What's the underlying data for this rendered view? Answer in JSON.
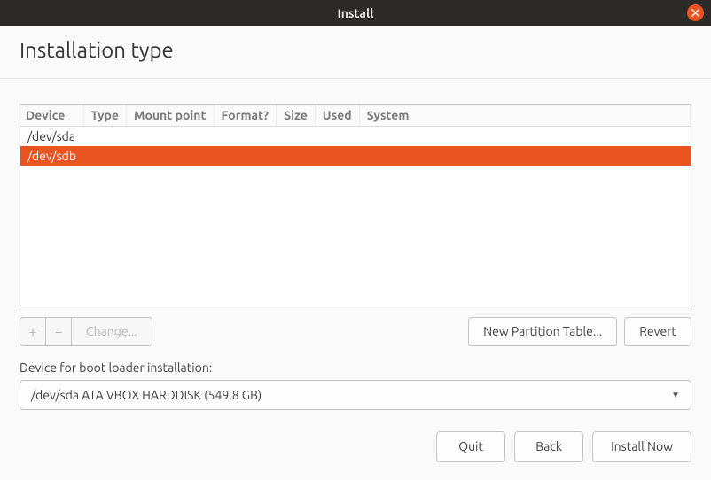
{
  "window": {
    "title": "Install"
  },
  "page": {
    "heading": "Installation type"
  },
  "table": {
    "headers": [
      "Device",
      "Type",
      "Mount point",
      "Format?",
      "Size",
      "Used",
      "System"
    ],
    "rows": [
      {
        "device": "/dev/sda",
        "type": "",
        "mount": "",
        "format": "",
        "size": "",
        "used": "",
        "system": "",
        "selected": false
      },
      {
        "device": "/dev/sdb",
        "type": "",
        "mount": "",
        "format": "",
        "size": "",
        "used": "",
        "system": "",
        "selected": true
      }
    ]
  },
  "toolbar": {
    "add": "+",
    "remove": "−",
    "change": "Change...",
    "new_partition_table": "New Partition Table...",
    "revert": "Revert"
  },
  "bootloader": {
    "label": "Device for boot loader installation:",
    "value": "/dev/sda  ATA VBOX HARDDISK (549.8 GB)"
  },
  "footer": {
    "quit": "Quit",
    "back": "Back",
    "install": "Install Now"
  }
}
